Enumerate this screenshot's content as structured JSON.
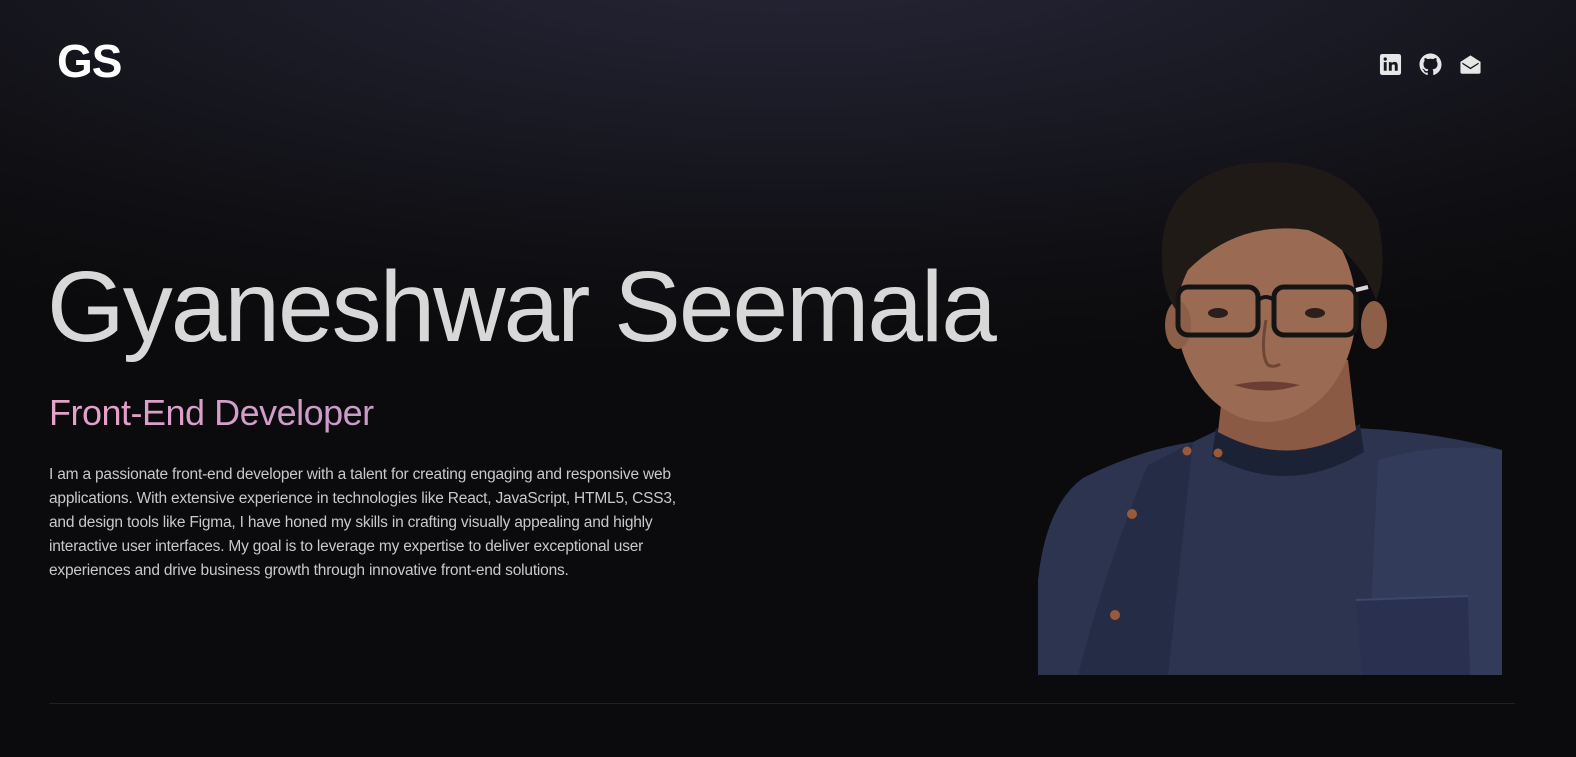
{
  "header": {
    "logo_text": "GS",
    "social": [
      {
        "icon": "linkedin-icon",
        "label": "LinkedIn"
      },
      {
        "icon": "github-icon",
        "label": "GitHub"
      },
      {
        "icon": "mail-icon",
        "label": "Email"
      }
    ]
  },
  "hero": {
    "name": "Gyaneshwar Seemala",
    "role": "Front-End Developer",
    "bio": "I am a passionate front-end developer with a talent for creating engaging and responsive web applications. With extensive experience in technologies like React, JavaScript, HTML5, CSS3, and design tools like Figma, I have honed my skills in crafting visually appealing and highly interactive user interfaces. My goal is to leverage my expertise to deliver exceptional user experiences and drive business growth through innovative front-end solutions."
  },
  "colors": {
    "background": "#0b0b0d",
    "name_text": "#d8d8d8",
    "role_gradient_start": "#e6a2c8",
    "role_gradient_end": "#c79bc9",
    "body_text": "#c9c9cc"
  }
}
